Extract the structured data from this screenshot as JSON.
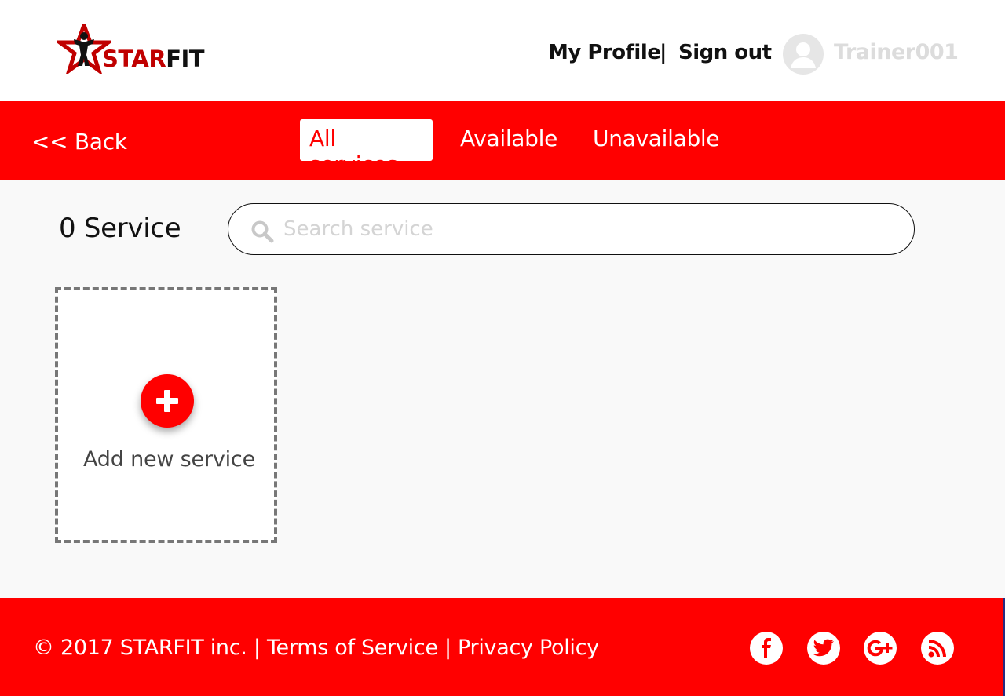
{
  "header": {
    "logo_text_star": "STAR",
    "logo_text_fit": "FIT",
    "my_profile_label": "My Profile",
    "separator": "|",
    "sign_out_label": "Sign out",
    "username": "Trainer001"
  },
  "nav": {
    "back_label": "<< Back",
    "tabs": [
      {
        "label": "All services",
        "active": true
      },
      {
        "label": "Available",
        "active": false
      },
      {
        "label": "Unavailable",
        "active": false
      }
    ]
  },
  "main": {
    "service_count": "0 Service",
    "search_placeholder": "Search service",
    "add_new_label": "Add new service"
  },
  "footer": {
    "copyright": "© 2017 STARFIT inc.",
    "sep": "|",
    "terms_label": "Terms of Service",
    "privacy_label": "Privacy Policy",
    "social": [
      "facebook-icon",
      "twitter-icon",
      "google-plus-icon",
      "rss-icon"
    ]
  },
  "colors": {
    "brand_red": "#ff0000",
    "logo_red": "#c00000",
    "text_dark": "#111111",
    "muted": "#dcdcdc"
  }
}
